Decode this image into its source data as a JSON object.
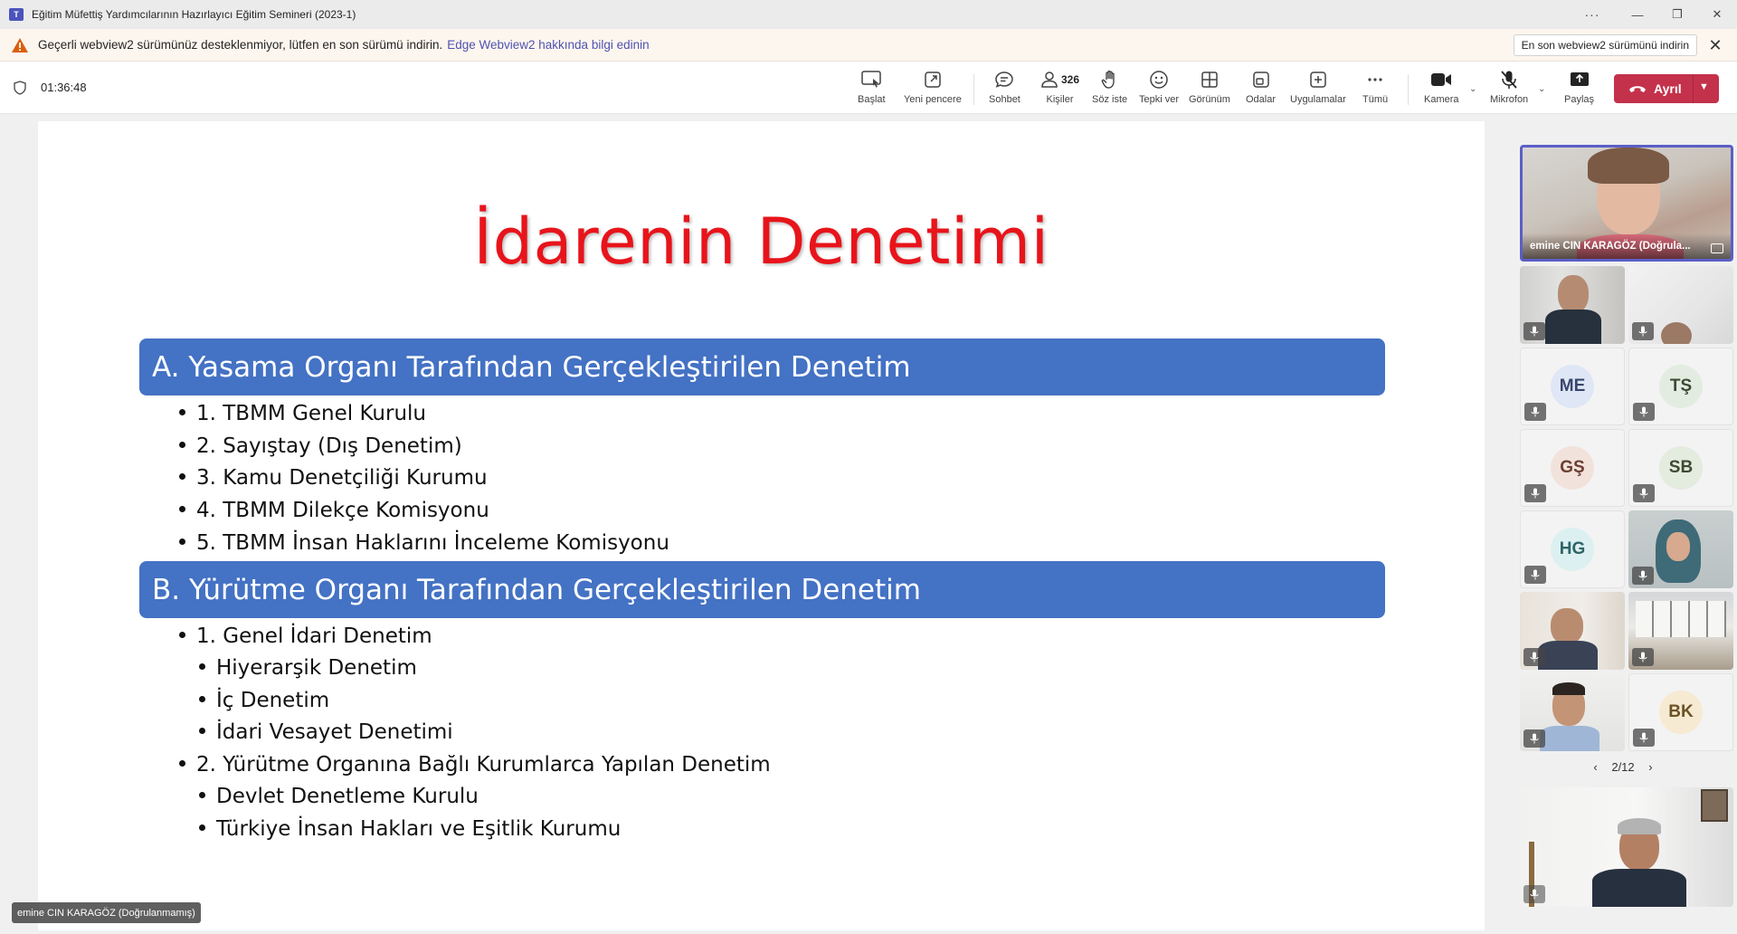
{
  "window": {
    "title": "Eğitim Müfettiş Yardımcılarının Hazırlayıcı Eğitim Semineri (2023-1)"
  },
  "warning": {
    "text": "Geçerli webview2 sürümünüz desteklenmiyor, lütfen en son sürümü indirin.",
    "link": "Edge Webview2 hakkında bilgi edinin",
    "download_label": "En son webview2 sürümünü indirin"
  },
  "toolbar": {
    "timer": "01:36:48",
    "items": [
      {
        "label": "Başlat",
        "icon": "present-icon"
      },
      {
        "label": "Yeni pencere",
        "icon": "new-window-icon"
      },
      {
        "label": "Sohbet",
        "icon": "chat-icon"
      },
      {
        "label": "Kişiler",
        "icon": "people-icon",
        "count": "326"
      },
      {
        "label": "Söz iste",
        "icon": "raise-hand-icon"
      },
      {
        "label": "Tepki ver",
        "icon": "emoji-icon"
      },
      {
        "label": "Görünüm",
        "icon": "view-icon"
      },
      {
        "label": "Odalar",
        "icon": "rooms-icon"
      },
      {
        "label": "Uygulamalar",
        "icon": "apps-icon"
      },
      {
        "label": "Tümü",
        "icon": "more-icon"
      },
      {
        "label": "Kamera",
        "icon": "camera-icon"
      },
      {
        "label": "Mikrofon",
        "icon": "mic-off-icon"
      },
      {
        "label": "Paylaş",
        "icon": "share-icon"
      }
    ],
    "leave_label": "Ayrıl"
  },
  "slide": {
    "title": "İdarenin Denetimi",
    "section_a": {
      "heading": "A. Yasama Organı Tarafından Gerçekleştirilen Denetim",
      "items": [
        "1. TBMM Genel Kurulu",
        "2. Sayıştay (Dış Denetim)",
        "3. Kamu Denetçiliği Kurumu",
        "4. TBMM Dilekçe Komisyonu",
        "5. TBMM İnsan Haklarını İnceleme Komisyonu"
      ]
    },
    "section_b": {
      "heading": "B. Yürütme Organı Tarafından Gerçekleştirilen Denetim",
      "items": [
        {
          "text": "1. Genel İdari Denetim",
          "level": 1
        },
        {
          "text": "Hiyerarşik Denetim",
          "level": 2
        },
        {
          "text": "İç Denetim",
          "level": 2
        },
        {
          "text": "İdari Vesayet Denetimi",
          "level": 2
        },
        {
          "text": "2. Yürütme Organına Bağlı Kurumlarca Yapılan Denetim",
          "level": 1
        },
        {
          "text": "Devlet Denetleme Kurulu",
          "level": 2
        },
        {
          "text": "Türkiye İnsan Hakları ve Eşitlik Kurumu",
          "level": 2
        }
      ]
    }
  },
  "presenter_tag": "emine CIN KARAGÖZ (Doğrulanmamış)",
  "participants": {
    "active_name": "emine CIN KARAGÖZ (Doğrula...",
    "initials": [
      "ME",
      "TŞ",
      "GŞ",
      "SB",
      "HG",
      "BK"
    ],
    "initial_colors": {
      "ME": {
        "bg": "#dfe6f5",
        "fg": "#39466b"
      },
      "TŞ": {
        "bg": "#e3ece1",
        "fg": "#3b4b36"
      },
      "GŞ": {
        "bg": "#f2e2dc",
        "fg": "#6b3e30"
      },
      "SB": {
        "bg": "#e4ebdf",
        "fg": "#3d4a33"
      },
      "HG": {
        "bg": "#dcf0f1",
        "fg": "#2d6468"
      },
      "BK": {
        "bg": "#f6ead2",
        "fg": "#6c5326"
      }
    },
    "pager": "2/12"
  },
  "colors": {
    "section_bar": "#4472c4",
    "slide_title": "#e8141b",
    "leave_button": "#c4314b",
    "active_border": "#5b5fc7"
  }
}
